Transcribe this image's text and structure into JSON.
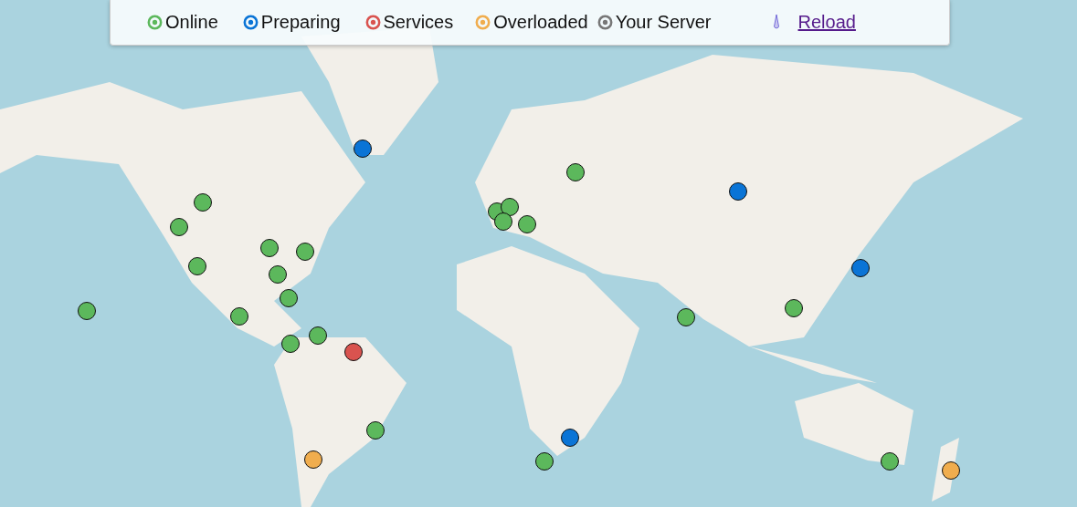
{
  "legend": [
    {
      "label": "Online",
      "color": "#5cb85c"
    },
    {
      "label": "Preparing",
      "color": "#0a74d6"
    },
    {
      "label": "Services",
      "color": "#d9534f"
    },
    {
      "label": "Overloaded",
      "color": "#f0ad4e"
    },
    {
      "label": "Your Server",
      "color": "#777777"
    }
  ],
  "reload": {
    "label": "Reload"
  },
  "map": {
    "kind": "picture",
    "markers": [
      {
        "color": "#0a74d6"
      },
      {
        "color": "#5cb85c"
      },
      {
        "color": "#5cb85c"
      },
      {
        "color": "#0a74d6"
      },
      {
        "color": "#5cb85c"
      },
      {
        "color": "#5cb85c"
      },
      {
        "color": "#5cb85c"
      },
      {
        "color": "#5cb85c"
      },
      {
        "color": "#5cb85c"
      },
      {
        "color": "#5cb85c"
      },
      {
        "color": "#5cb85c"
      },
      {
        "color": "#5cb85c"
      },
      {
        "color": "#5cb85c"
      },
      {
        "color": "#0a74d6"
      },
      {
        "color": "#5cb85c"
      },
      {
        "color": "#5cb85c"
      },
      {
        "color": "#5cb85c"
      },
      {
        "color": "#5cb85c"
      },
      {
        "color": "#5cb85c"
      },
      {
        "color": "#5cb85c"
      },
      {
        "color": "#5cb85c"
      },
      {
        "color": "#d9534f"
      },
      {
        "color": "#5cb85c"
      },
      {
        "color": "#0a74d6"
      },
      {
        "color": "#f0ad4e"
      },
      {
        "color": "#5cb85c"
      },
      {
        "color": "#5cb85c"
      },
      {
        "color": "#f0ad4e"
      }
    ]
  }
}
